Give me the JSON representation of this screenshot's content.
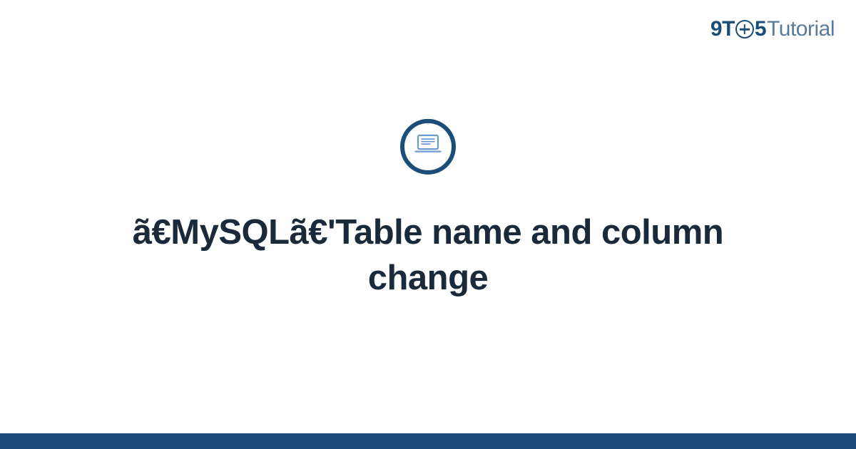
{
  "logo": {
    "part1": "9",
    "part2": "T",
    "part3": "5",
    "part4": "Tutorial"
  },
  "main": {
    "title": "ã€MySQLã€'Table name and column change"
  },
  "colors": {
    "brand": "#1a4d7a",
    "text": "#1a2a3a"
  }
}
